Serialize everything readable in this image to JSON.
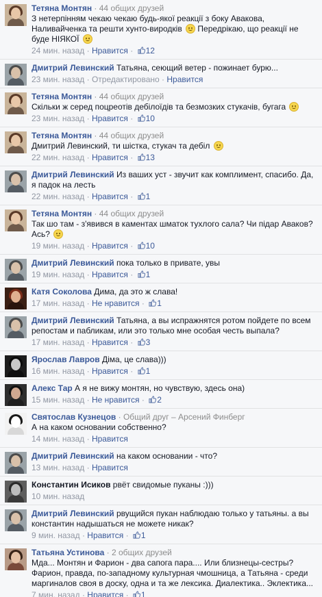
{
  "ui": {
    "dot": "·",
    "like_icon": "thumbs-up-icon",
    "emoji_icon": "smiley-icon"
  },
  "comments": [
    {
      "avatar": {
        "bg": "#c9b49a",
        "hair": "#5a3a28",
        "skin": "#e8c7a8",
        "body": "#6f5a4a"
      },
      "author": "Тетяна Монтян",
      "author_dark": false,
      "meta_suffix": "· 44 общих друзей",
      "lines": [
        "З нетерпінням чекаю чекаю будь-якої реакції з боку Авакова,",
        "Наливайченка та решти хунто-виродків [e] Передрікаю, що реакції не",
        "буде НІЯКОЇ [e]"
      ],
      "time": "24 мин. назад",
      "action": "Нравится",
      "likes": "12"
    },
    {
      "avatar": {
        "bg": "#9aa3a8",
        "hair": "#4b4b4b",
        "skin": "#d9c1aa",
        "body": "#555c63"
      },
      "author": "Дмитрий Левинский",
      "author_dark": false,
      "meta_suffix": "",
      "first_text": "Татьяна, сеющий ветер - пожинает бурю...",
      "lines": [],
      "time": "23 мин. назад",
      "status": "Отредактировано",
      "action": "Нравится",
      "likes": ""
    },
    {
      "avatar": {
        "bg": "#c9b49a",
        "hair": "#5a3a28",
        "skin": "#e8c7a8",
        "body": "#6f5a4a"
      },
      "author": "Тетяна Монтян",
      "author_dark": false,
      "meta_suffix": "· 44 общих друзей",
      "lines": [
        "Скільки ж серед поцреотів дебілоїдів та безмозких стукачів, бугага [e]"
      ],
      "time": "23 мин. назад",
      "action": "Нравится",
      "likes": "10"
    },
    {
      "avatar": {
        "bg": "#c9b49a",
        "hair": "#5a3a28",
        "skin": "#e8c7a8",
        "body": "#6f5a4a"
      },
      "author": "Тетяна Монтян",
      "author_dark": false,
      "meta_suffix": "· 44 общих друзей",
      "lines": [
        "Дмитрий Левинский, ти шістка, стукач та дебіл [e]"
      ],
      "time": "22 мин. назад",
      "action": "Нравится",
      "likes": "13"
    },
    {
      "avatar": {
        "bg": "#9aa3a8",
        "hair": "#4b4b4b",
        "skin": "#d9c1aa",
        "body": "#555c63"
      },
      "author": "Дмитрий Левинский",
      "author_dark": false,
      "meta_suffix": "",
      "first_text": "Из ваших уст - звучит как комплимент, спасибо. Да,",
      "lines": [
        "я падок на лесть"
      ],
      "time": "22 мин. назад",
      "action": "Нравится",
      "likes": "1"
    },
    {
      "avatar": {
        "bg": "#c9b49a",
        "hair": "#5a3a28",
        "skin": "#e8c7a8",
        "body": "#6f5a4a"
      },
      "author": "Тетяна Монтян",
      "author_dark": false,
      "meta_suffix": "· 44 общих друзей",
      "lines": [
        "Так шо там - з'явився в каментах шматок тухлого сала? Чи підар Аваков?",
        "Ась? [e]"
      ],
      "time": "19 мин. назад",
      "action": "Нравится",
      "likes": "10"
    },
    {
      "avatar": {
        "bg": "#9aa3a8",
        "hair": "#4b4b4b",
        "skin": "#d9c1aa",
        "body": "#555c63"
      },
      "author": "Дмитрий Левинский",
      "author_dark": false,
      "meta_suffix": "",
      "first_text": "пока только в привате, увы",
      "lines": [],
      "time": "19 мин. назад",
      "action": "Нравится",
      "likes": "1"
    },
    {
      "avatar": {
        "bg": "#3a1f14",
        "hair": "#7a2c18",
        "skin": "#e0b090",
        "body": "#2a140d"
      },
      "author": "Катя Соколова",
      "author_dark": false,
      "meta_suffix": "",
      "first_text": "Дима, да это ж слава!",
      "lines": [],
      "time": "17 мин. назад",
      "action": "Не нравится",
      "likes": "1"
    },
    {
      "avatar": {
        "bg": "#9aa3a8",
        "hair": "#4b4b4b",
        "skin": "#d9c1aa",
        "body": "#555c63"
      },
      "author": "Дмитрий Левинский",
      "author_dark": false,
      "meta_suffix": "",
      "first_text": "Татьяна, а вы испражнятся ротом пойдете по всем",
      "lines": [
        "репостам и пабликам, или это только мне особая честь выпала?"
      ],
      "time": "17 мин. назад",
      "action": "Нравится",
      "likes": "3"
    },
    {
      "avatar": {
        "bg": "#1c1c1c",
        "hair": "#0a0a0a",
        "skin": "#c8c8c8",
        "body": "#0f0f0f"
      },
      "author": "Ярослав Лавров",
      "author_dark": false,
      "meta_suffix": "",
      "first_text": "Діма, це слава)))",
      "lines": [],
      "time": "16 мин. назад",
      "action": "Нравится",
      "likes": "1"
    },
    {
      "avatar": {
        "bg": "#2e2e2e",
        "hair": "#111111",
        "skin": "#d0a890",
        "body": "#1f1f1f"
      },
      "author": "Алекс Тар",
      "author_dark": false,
      "meta_suffix": "",
      "first_text": "А я не вижу монтян, но чувствую, здесь она)",
      "lines": [],
      "time": "15 мин. назад",
      "action": "Не нравится",
      "likes": "2"
    },
    {
      "avatar": {
        "bg": "#f2f2f2",
        "hair": "#1a1a1a",
        "skin": "#ffffff",
        "body": "#d8d8d8"
      },
      "author": "Святослав Кузнецов",
      "author_dark": false,
      "meta_suffix": "· Общий друг – Арсений Финберг",
      "lines": [
        "А на каком основании собственно?"
      ],
      "time": "14 мин. назад",
      "action": "Нравится",
      "likes": ""
    },
    {
      "avatar": {
        "bg": "#9aa3a8",
        "hair": "#4b4b4b",
        "skin": "#d9c1aa",
        "body": "#555c63"
      },
      "author": "Дмитрий Левинский",
      "author_dark": false,
      "meta_suffix": "",
      "first_text": "на каком основании - что?",
      "lines": [],
      "time": "13 мин. назад",
      "action": "Нравится",
      "likes": ""
    },
    {
      "avatar": {
        "bg": "#5e5e5e",
        "hair": "#2a2a2a",
        "skin": "#bdbdbd",
        "body": "#3a3a3a"
      },
      "author": "Константин Исиков",
      "author_dark": true,
      "meta_suffix": "",
      "first_text": "рвёт свидомые пуканы :)))",
      "lines": [],
      "time": "10 мин. назад",
      "action": "",
      "likes": ""
    },
    {
      "avatar": {
        "bg": "#9aa3a8",
        "hair": "#4b4b4b",
        "skin": "#d9c1aa",
        "body": "#555c63"
      },
      "author": "Дмитрий Левинский",
      "author_dark": false,
      "meta_suffix": "",
      "first_text": "рвущийся пукан наблюдаю только у татьяны. а вы",
      "lines": [
        "константин надышаться не можете никак?"
      ],
      "time": "9 мин. назад",
      "action": "Нравится",
      "likes": "1"
    },
    {
      "avatar": {
        "bg": "#b89a86",
        "hair": "#3a2418",
        "skin": "#e6c2a6",
        "body": "#7a4a3a"
      },
      "author": "Татьяна Устинова",
      "author_dark": false,
      "meta_suffix": "· 2 общих друзей",
      "lines": [
        "Мда... Монтян и Фарион - два сапога пара.... Или близнецы-сестры?",
        "Фарион, правда, по-западному культурная чмошница, а Татьяна - среди",
        "маргиналов своя в доску, одна и та же лексика. Диалектика.. Эклектика..."
      ],
      "time": "7 мин. назад",
      "action": "Нравится",
      "likes": "1"
    }
  ]
}
